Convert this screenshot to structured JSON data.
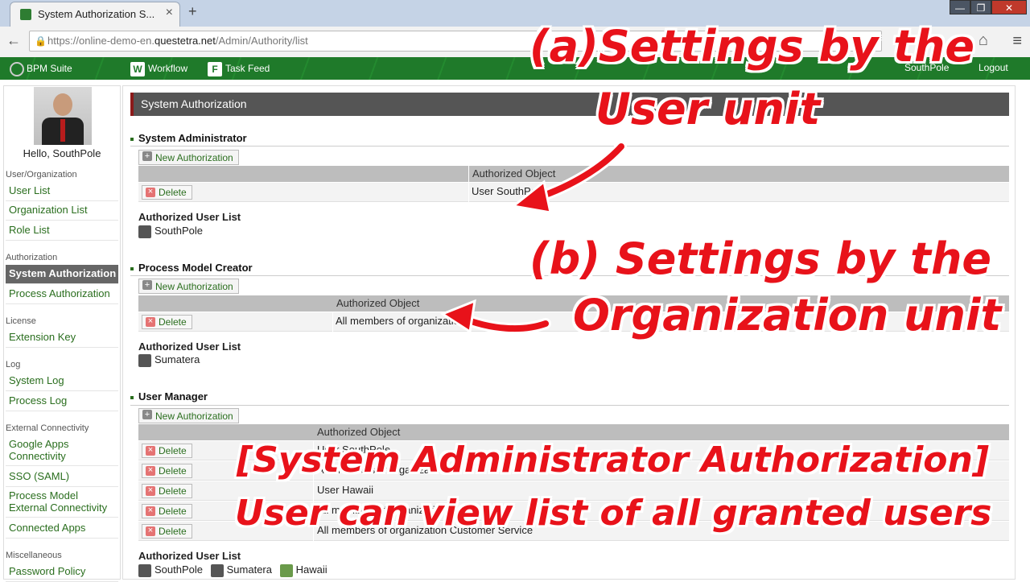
{
  "browser": {
    "tab_title": "System Authorization S...",
    "tab_close": "×",
    "new_tab": "+",
    "url_prefix": "https://online-demo-en.",
    "url_host": "questetra.net",
    "url_path": "/Admin/Authority/list",
    "window_buttons": [
      "—",
      "❐",
      "✕"
    ]
  },
  "appbar": {
    "logo": "BPM Suite",
    "workflow": "Workflow",
    "taskfeed": "Task Feed",
    "user": "SouthPole",
    "logout": "Logout"
  },
  "sidebar": {
    "greeting": "Hello, SouthPole",
    "sections": {
      "user_org": "User/Organization",
      "authorization": "Authorization",
      "license": "License",
      "log": "Log",
      "external": "External Connectivity",
      "misc": "Miscellaneous"
    },
    "items": {
      "user_list": "User List",
      "org_list": "Organization List",
      "role_list": "Role List",
      "system_auth": "System Authorization",
      "process_auth": "Process Authorization",
      "extension_key": "Extension Key",
      "system_log": "System Log",
      "process_log": "Process Log",
      "google_apps": "Google Apps Connectivity",
      "sso": "SSO (SAML)",
      "pm_external": "Process Model External Connectivity",
      "connected_apps": "Connected Apps",
      "password_policy": "Password Policy"
    }
  },
  "page": {
    "title": "System Authorization",
    "new_auth": "New Authorization",
    "delete": "Delete",
    "authorized_object": "Authorized Object",
    "authorized_user_list": "Authorized User List",
    "sections": [
      {
        "title": "System Administrator",
        "rows": [
          "User SouthPole"
        ],
        "users": [
          "SouthPole"
        ]
      },
      {
        "title": "Process Model Creator",
        "rows": [
          "All members of organization"
        ],
        "users": [
          "Sumatera"
        ]
      },
      {
        "title": "User Manager",
        "rows": [
          "User SouthPole",
          "All members of organization",
          "User Hawaii",
          "All members of organization Service",
          "All members of organization Customer Service"
        ],
        "users": [
          "SouthPole",
          "Sumatera",
          "Hawaii"
        ]
      }
    ]
  },
  "overlays": {
    "a_line1": "(a)Settings by the",
    "a_line2": "User unit",
    "b_line1": "(b) Settings by the",
    "b_line2": "Organization unit",
    "c_line1": "[System Administrator Authorization]",
    "c_line2": "User can view list of all granted users"
  },
  "colors": {
    "accent_green": "#1f7a2a",
    "overlay_red": "#e8121a"
  }
}
